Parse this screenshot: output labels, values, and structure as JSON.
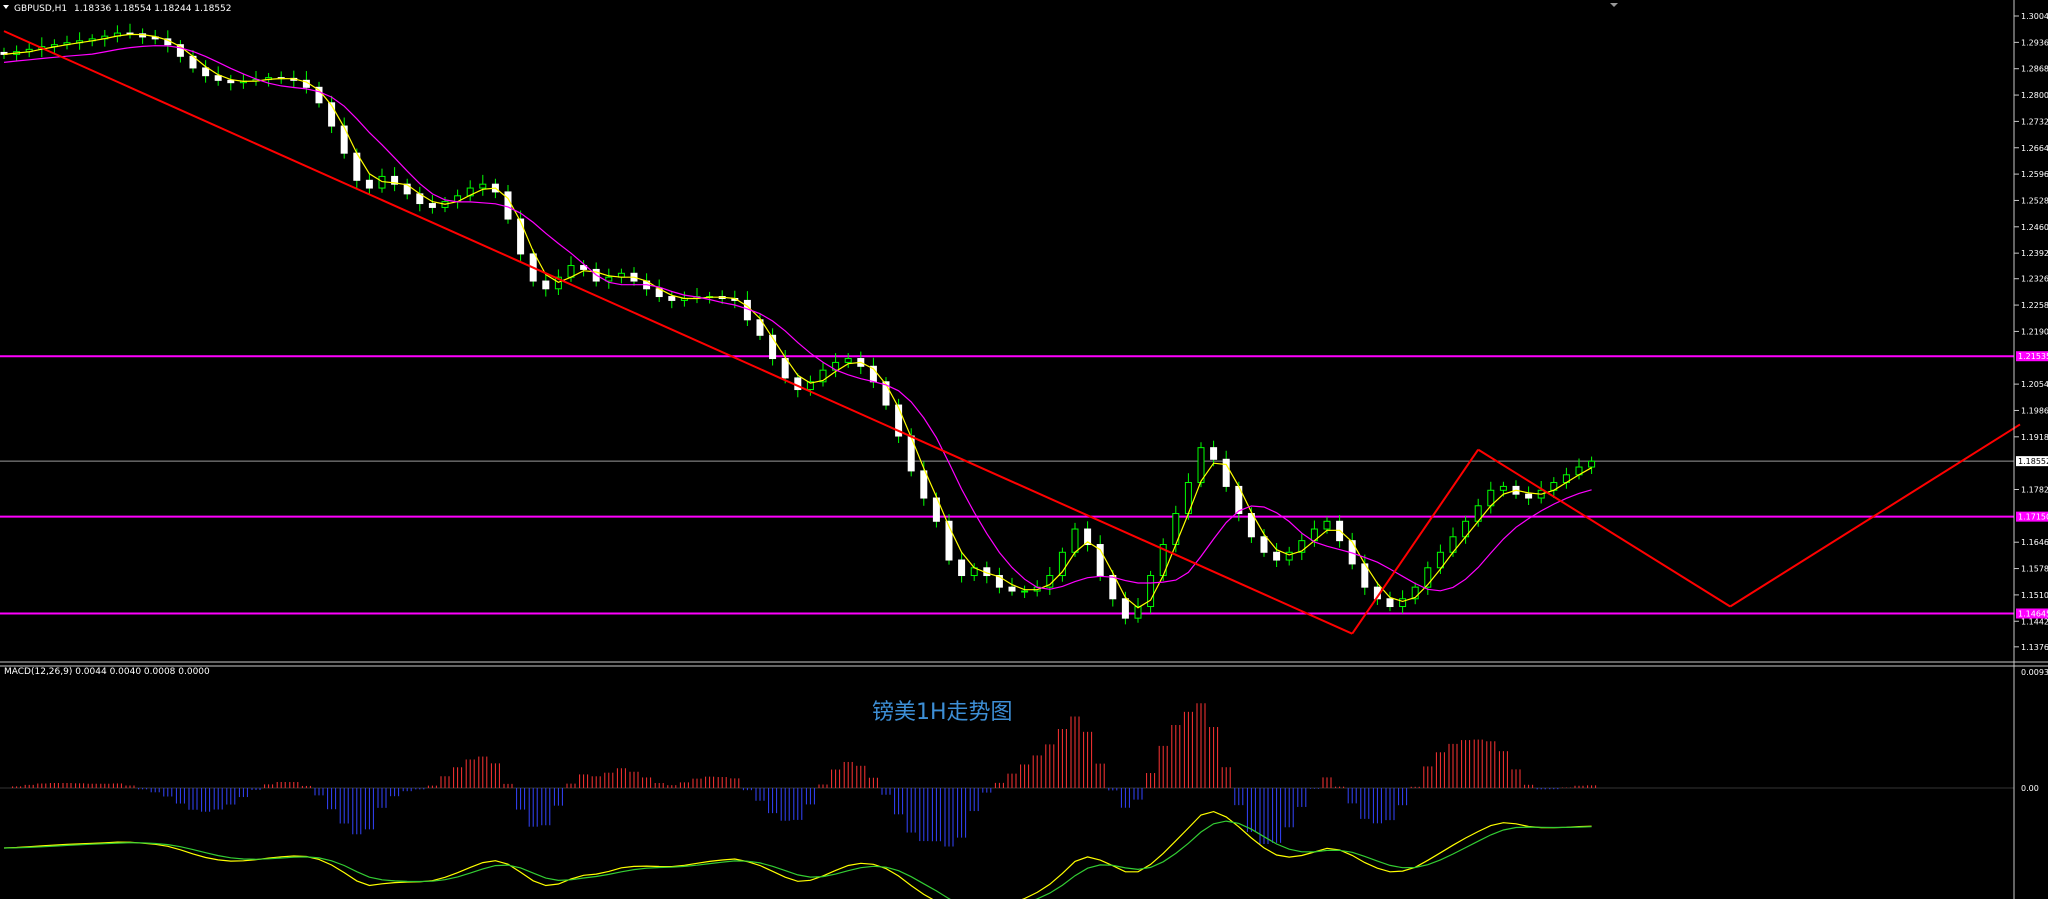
{
  "chart_data": [
    {
      "type": "candlestick",
      "title": "GBPUSD,H1",
      "ohlc_header": "1.18336 1.18554 1.18244 1.18552",
      "open": 1.18336,
      "high": 1.18554,
      "low": 1.18244,
      "close": 1.18552,
      "ylim": [
        1.1342,
        1.3035
      ],
      "y_ticks": [
        "1.30040",
        "1.29360",
        "1.28680",
        "1.28000",
        "1.27320",
        "1.26640",
        "1.25960",
        "1.25280",
        "1.24600",
        "1.23920",
        "1.23260",
        "1.22580",
        "1.21900",
        "1.20540",
        "1.19860",
        "1.19180",
        "1.17820",
        "1.16460",
        "1.15780",
        "1.15100",
        "1.14420",
        "1.13760"
      ],
      "current_price_label": "1.18552",
      "horizontal_levels": [
        {
          "label": "1.21535",
          "value": 1.2126,
          "color": "#ff00ff"
        },
        {
          "label": "1.17150",
          "value": 1.1712,
          "color": "#ff00ff"
        },
        {
          "label": "1.14645",
          "value": 1.1462,
          "color": "#ff00ff"
        }
      ],
      "current_price_line": 1.18552,
      "closes": [
        1.2905,
        1.2912,
        1.2918,
        1.2925,
        1.293,
        1.2935,
        1.294,
        1.2945,
        1.2952,
        1.296,
        1.2958,
        1.295,
        1.2945,
        1.293,
        1.29,
        1.287,
        1.285,
        1.2838,
        1.2832,
        1.2836,
        1.284,
        1.2845,
        1.2843,
        1.2838,
        1.282,
        1.278,
        1.272,
        1.265,
        1.258,
        1.256,
        1.259,
        1.257,
        1.2545,
        1.252,
        1.251,
        1.2525,
        1.254,
        1.256,
        1.257,
        1.255,
        1.248,
        1.239,
        1.232,
        1.23,
        1.233,
        1.236,
        1.235,
        1.232,
        1.233,
        1.234,
        1.232,
        1.23,
        1.228,
        1.227,
        1.2275,
        1.228,
        1.228,
        1.2275,
        1.227,
        1.222,
        1.218,
        1.212,
        1.207,
        1.204,
        1.206,
        1.209,
        1.211,
        1.212,
        1.21,
        1.206,
        1.2,
        1.192,
        1.183,
        1.176,
        1.17,
        1.16,
        1.156,
        1.158,
        1.156,
        1.153,
        1.152,
        1.152,
        1.153,
        1.156,
        1.162,
        1.168,
        1.164,
        1.156,
        1.15,
        1.145,
        1.148,
        1.156,
        1.164,
        1.172,
        1.18,
        1.189,
        1.186,
        1.179,
        1.172,
        1.166,
        1.162,
        1.16,
        1.162,
        1.165,
        1.168,
        1.17,
        1.165,
        1.159,
        1.153,
        1.15,
        1.148,
        1.15,
        1.153,
        1.158,
        1.162,
        1.166,
        1.17,
        1.174,
        1.178,
        1.179,
        1.177,
        1.176,
        1.178,
        1.18,
        1.182,
        1.184,
        1.1855
      ],
      "moving_averages": [
        {
          "color": "#ffff00"
        },
        {
          "color": "#ff00ff"
        }
      ],
      "trendlines": [
        {
          "points": [
            [
              0,
              1.2965
            ],
            [
              107,
              1.141
            ]
          ],
          "color": "#ff0000"
        },
        {
          "points": [
            [
              107,
              1.141
            ],
            [
              117,
              1.1885
            ]
          ],
          "color": "#ff0000"
        },
        {
          "points": [
            [
              117,
              1.1885
            ],
            [
              137,
              1.148
            ]
          ],
          "color": "#ff0000"
        },
        {
          "points": [
            [
              137,
              1.148
            ],
            [
              160,
              1.195
            ]
          ],
          "color": "#ff0000"
        }
      ],
      "arrow": {
        "from": [
          164,
          1.178
        ],
        "to": [
          168,
          1.211
        ],
        "color": "#ff00ff"
      }
    },
    {
      "type": "bar",
      "title": "MACD(12,26,9) 0.0044 0.0040 0.0008 0.0000",
      "ylim": [
        -0.008,
        0.0093
      ],
      "y_ticks": [
        "0.0093",
        "0.00"
      ],
      "zero_line_label": "0.00",
      "series_colors": {
        "positive": "#ff3333",
        "negative": "#3344ff",
        "macd": "#ffff00",
        "signal": "#33cc33"
      }
    }
  ],
  "watermark": "镑美1H走势图"
}
